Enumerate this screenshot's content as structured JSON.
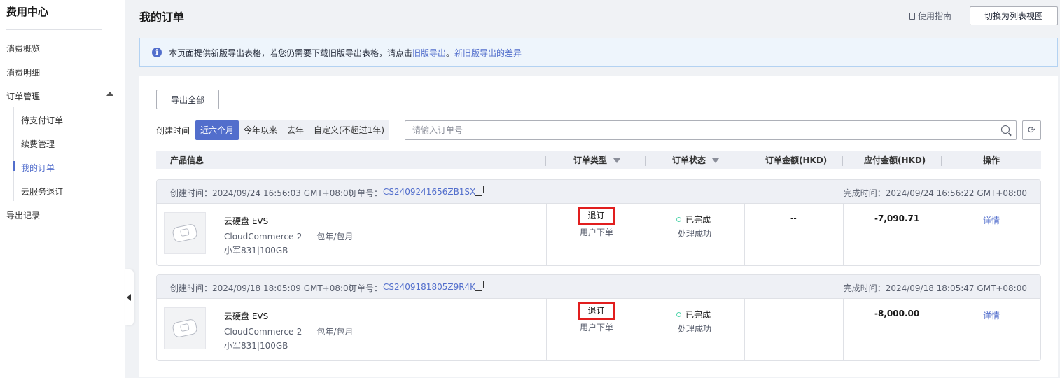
{
  "sidebar": {
    "title": "费用中心",
    "items": [
      {
        "label": "消费概览"
      },
      {
        "label": "消费明细"
      },
      {
        "label": "订单管理"
      },
      {
        "label": "待支付订单"
      },
      {
        "label": "续费管理"
      },
      {
        "label": "我的订单"
      },
      {
        "label": "云服务退订"
      },
      {
        "label": "导出记录"
      }
    ],
    "active_item": "我的订单"
  },
  "header": {
    "title": "我的订单",
    "guide_label": "使用指南",
    "switch_view_label": "切换为列表视图"
  },
  "banner": {
    "text": "本页面提供新版导出表格，若您仍需要下载旧版导出表格，请点击",
    "old_export_link": "旧版导出",
    "separator": "。",
    "diff_link": "新旧版导出的差异"
  },
  "toolbar": {
    "export_all_label": "导出全部",
    "created_time_label": "创建时间",
    "time_ranges": [
      "近六个月",
      "今年以来",
      "去年",
      "自定义(不超过1年)"
    ],
    "selected_time_range": "近六个月",
    "search_placeholder": "请输入订单号"
  },
  "table": {
    "columns": [
      "产品信息",
      "订单类型",
      "订单状态",
      "订单金额(HKD)",
      "应付金额(HKD)",
      "操作"
    ]
  },
  "orders": [
    {
      "created": "创建时间：2024/09/24 16:56:03 GMT+08:00",
      "order_no_label": "订单号：",
      "order_no": "CS2409241656ZB1SX",
      "completed": "完成时间：2024/09/24 16:56:22 GMT+08:00",
      "product_name": "云硬盘 EVS",
      "region": "CloudCommerce-2",
      "billing": "包年/包月",
      "spec": "小军831|100GB",
      "type": "退订",
      "type_sub": "用户下单",
      "status": "已完成",
      "status_sub": "处理成功",
      "amount": "--",
      "payable": "-7,090.71",
      "action": "详情"
    },
    {
      "created": "创建时间：2024/09/18 18:05:09 GMT+08:00",
      "order_no_label": "订单号：",
      "order_no": "CS2409181805Z9R4K",
      "completed": "完成时间：2024/09/18 18:05:47 GMT+08:00",
      "product_name": "云硬盘 EVS",
      "region": "CloudCommerce-2",
      "billing": "包年/包月",
      "spec": "小军831|100GB",
      "type": "退订",
      "type_sub": "用户下单",
      "status": "已完成",
      "status_sub": "处理成功",
      "amount": "--",
      "payable": "-8,000.00",
      "action": "详情"
    }
  ],
  "colors": {
    "accent": "#526ecc",
    "highlight_border": "#e11e1e",
    "status_success": "#50d4ab"
  }
}
